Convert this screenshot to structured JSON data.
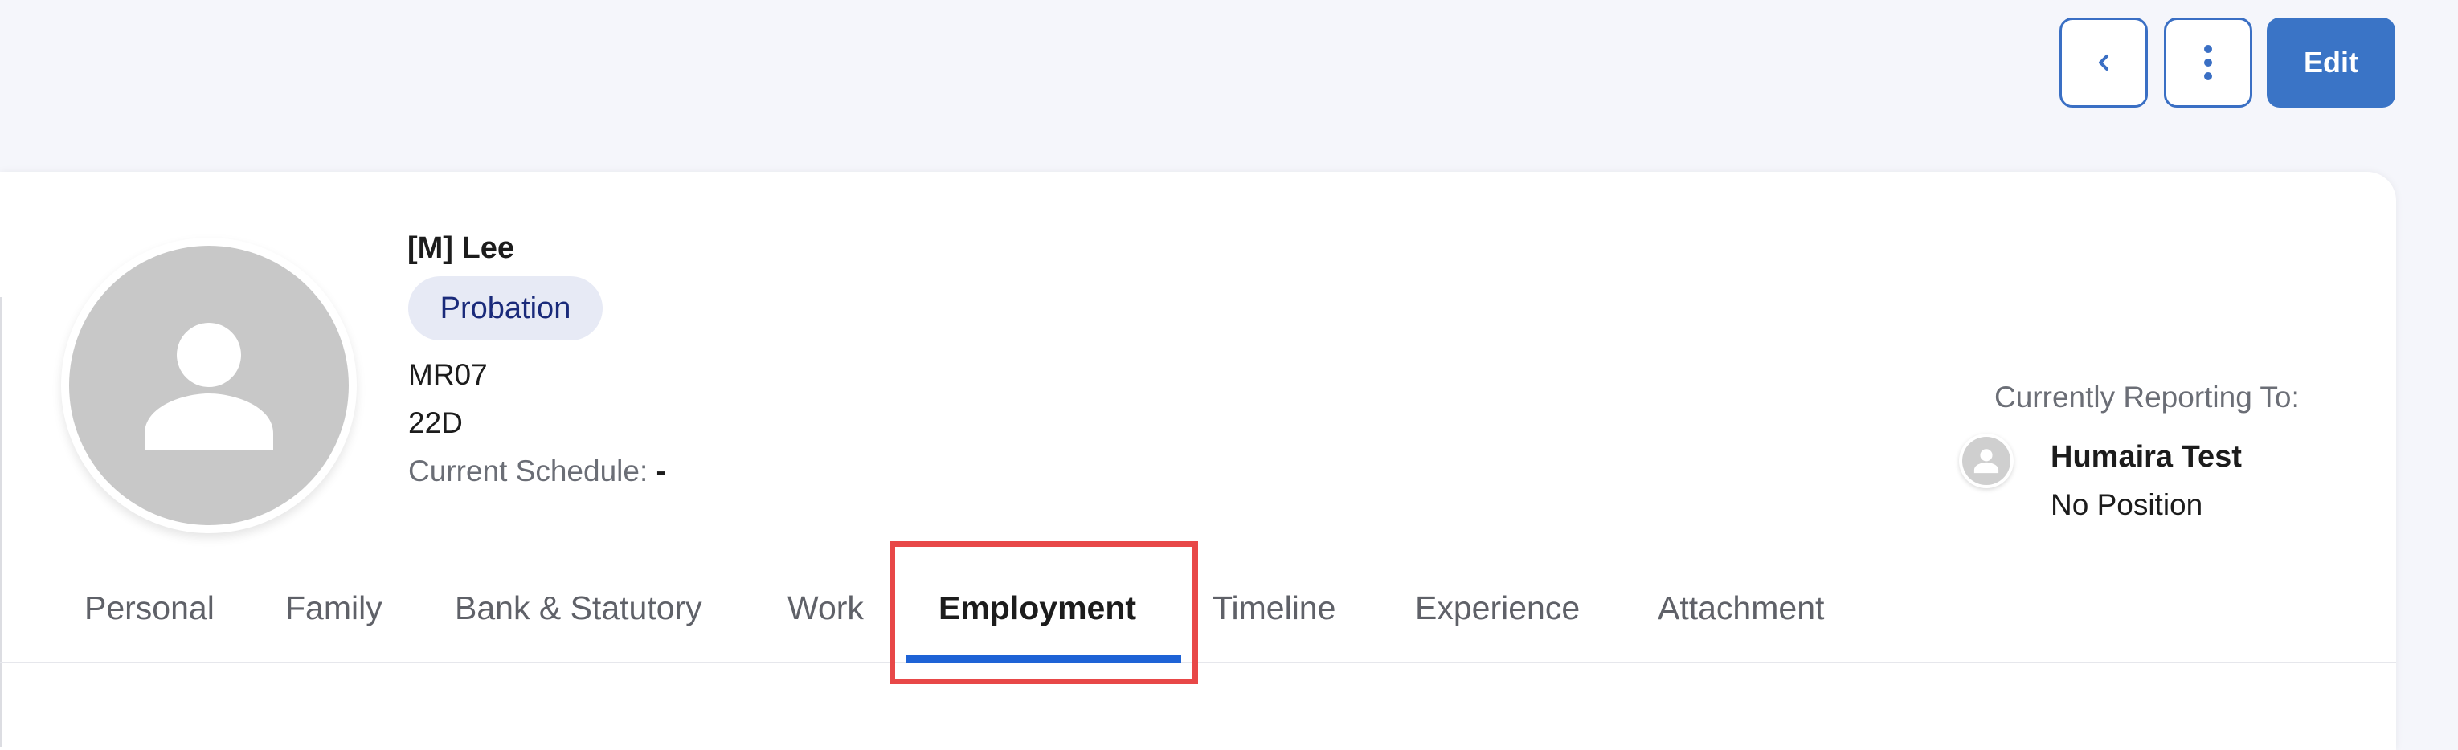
{
  "toolbar": {
    "back_icon": "chevron-left-icon",
    "more_icon": "vertical-dots-icon",
    "edit_label": "Edit",
    "accent_color": "#3a74c6"
  },
  "profile": {
    "avatar_icon": "user-placeholder-icon",
    "name": "[M] Lee",
    "status_badge": "Probation",
    "employee_code": "MR07",
    "grade": "22D",
    "schedule_label": "Current Schedule:",
    "schedule_value": "-"
  },
  "reporting": {
    "label": "Currently Reporting To:",
    "avatar_icon": "user-placeholder-icon",
    "manager_name": "Humaira Test",
    "manager_position": "No Position"
  },
  "tabs": [
    {
      "label": "Personal",
      "active": false
    },
    {
      "label": "Family",
      "active": false
    },
    {
      "label": "Bank & Statutory",
      "active": false
    },
    {
      "label": "Work",
      "active": false
    },
    {
      "label": "Employment",
      "active": true
    },
    {
      "label": "Timeline",
      "active": false
    },
    {
      "label": "Experience",
      "active": false
    },
    {
      "label": "Attachment",
      "active": false
    }
  ],
  "highlight_color": "#e84848"
}
